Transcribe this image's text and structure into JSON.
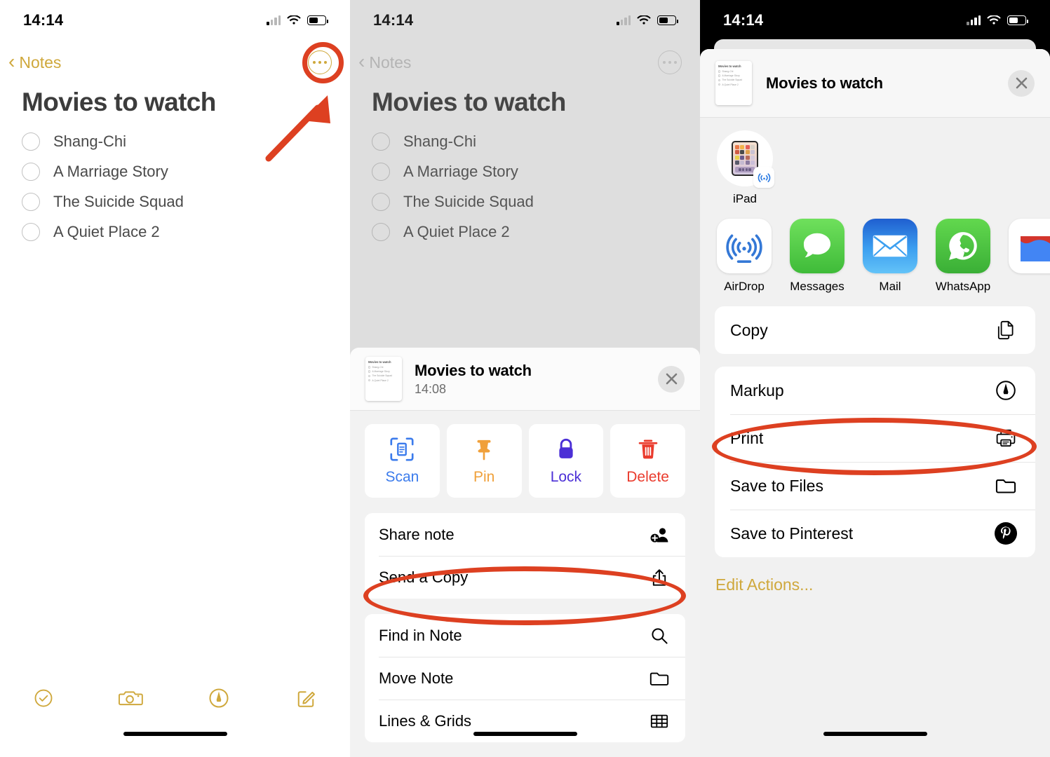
{
  "colors": {
    "notes_accent": "#cfa83c",
    "annotation_red": "#dd4021",
    "scan_blue": "#3b7bec",
    "pin_orange": "#f0a03a",
    "lock_purple": "#4b2fd6",
    "delete_red": "#ea3b2d",
    "sheet_bg": "#f1f1f1"
  },
  "panels": [
    {
      "id": "note-detail",
      "status": {
        "time": "14:14",
        "cellular_bars": 4,
        "wifi": true,
        "battery_pct": 55
      },
      "nav": {
        "back_label": "Notes",
        "more_button": "more-options"
      },
      "note": {
        "title": "Movies to watch",
        "items": [
          {
            "text": "Shang-Chi",
            "checked": false
          },
          {
            "text": "A Marriage Story",
            "checked": false
          },
          {
            "text": "The Suicide Squad",
            "checked": false
          },
          {
            "text": "A Quiet Place 2",
            "checked": false
          }
        ]
      },
      "toolbar": [
        {
          "icon": "checklist-icon",
          "label": "Checklist"
        },
        {
          "icon": "camera-icon",
          "label": "Camera"
        },
        {
          "icon": "markup-pen-icon",
          "label": "Markup"
        },
        {
          "icon": "compose-icon",
          "label": "New Note"
        }
      ],
      "annotations": [
        {
          "type": "ring",
          "target": "more-options-button"
        },
        {
          "type": "arrow",
          "target": "more-options-button"
        }
      ]
    },
    {
      "id": "note-options-sheet",
      "status": {
        "time": "14:14",
        "cellular_bars": 4,
        "wifi": true,
        "battery_pct": 55
      },
      "nav": {
        "back_label": "Notes",
        "more_button": "more-options"
      },
      "note": {
        "title": "Movies to watch",
        "items": [
          {
            "text": "Shang-Chi",
            "checked": false
          },
          {
            "text": "A Marriage Story",
            "checked": false
          },
          {
            "text": "The Suicide Squad",
            "checked": false
          },
          {
            "text": "A Quiet Place 2",
            "checked": false
          }
        ]
      },
      "sheet": {
        "header": {
          "title": "Movies to watch",
          "subtitle": "14:08",
          "close": "close-icon"
        },
        "quick_actions": [
          {
            "label": "Scan",
            "icon": "scan-document-icon",
            "color": "#3b7bec"
          },
          {
            "label": "Pin",
            "icon": "pin-icon",
            "color": "#f0a03a"
          },
          {
            "label": "Lock",
            "icon": "lock-icon",
            "color": "#4b2fd6"
          },
          {
            "label": "Delete",
            "icon": "trash-icon",
            "color": "#ea3b2d"
          }
        ],
        "groups": [
          {
            "rows": [
              {
                "label": "Share note",
                "icon": "add-person-icon"
              },
              {
                "label": "Send a Copy",
                "icon": "share-icon",
                "highlighted": true
              }
            ]
          },
          {
            "rows": [
              {
                "label": "Find in Note",
                "icon": "search-icon"
              },
              {
                "label": "Move Note",
                "icon": "folder-icon"
              },
              {
                "label": "Lines & Grids",
                "icon": "grid-icon"
              }
            ]
          }
        ]
      },
      "annotations": [
        {
          "type": "oval",
          "target": "send-a-copy-row"
        }
      ]
    },
    {
      "id": "share-sheet",
      "status": {
        "time": "14:14",
        "cellular_bars": 4,
        "wifi": true,
        "battery_pct": 55
      },
      "sheet": {
        "header": {
          "title": "Movies to watch",
          "close": "close-icon"
        },
        "airdrop_devices": [
          {
            "name": "iPad",
            "badge": "airdrop-icon"
          }
        ],
        "apps": [
          {
            "name": "AirDrop",
            "icon": "airdrop-icon"
          },
          {
            "name": "Messages",
            "icon": "messages-icon"
          },
          {
            "name": "Mail",
            "icon": "mail-icon"
          },
          {
            "name": "WhatsApp",
            "icon": "whatsapp-icon"
          },
          {
            "name": "",
            "icon": "drive-icon"
          }
        ],
        "actions": [
          {
            "label": "Copy",
            "icon": "copy-icon"
          },
          {
            "label": "Markup",
            "icon": "markup-pen-icon",
            "highlighted": true
          },
          {
            "label": "Print",
            "icon": "printer-icon"
          },
          {
            "label": "Save to Files",
            "icon": "folder-icon"
          },
          {
            "label": "Save to Pinterest",
            "icon": "pinterest-icon"
          }
        ],
        "edit_actions_label": "Edit Actions..."
      },
      "annotations": [
        {
          "type": "oval",
          "target": "markup-row"
        }
      ]
    }
  ]
}
